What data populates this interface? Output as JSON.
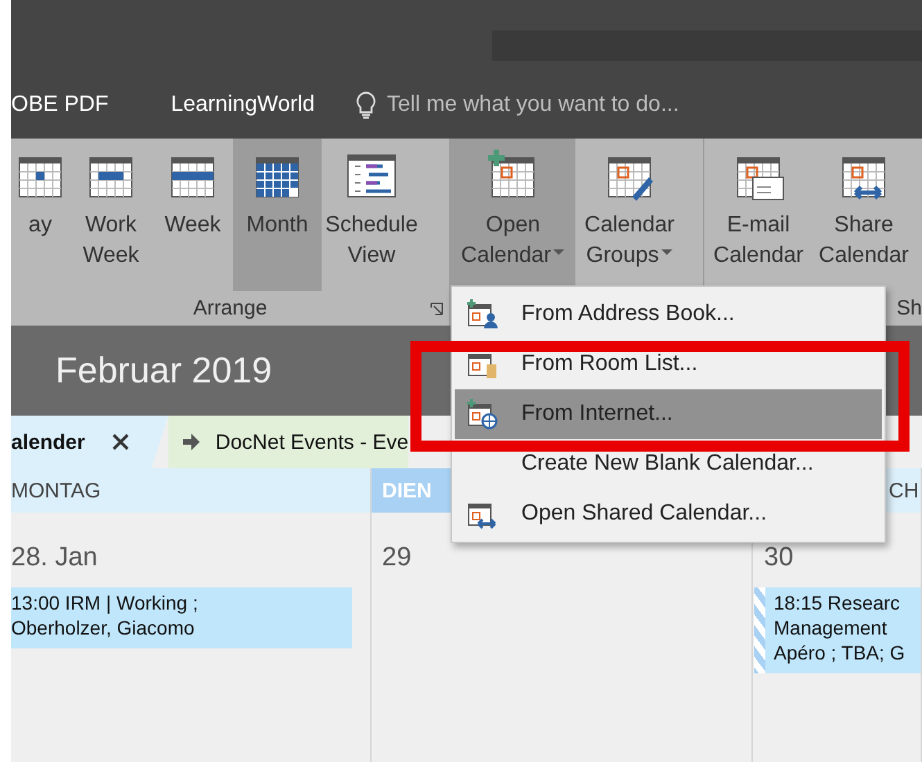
{
  "top_tabs": [
    {
      "label": "OBE PDF"
    },
    {
      "label": "LearningWorld"
    }
  ],
  "tell_me": {
    "placeholder": "Tell me what you want to do..."
  },
  "ribbon": {
    "buttons": [
      {
        "lines": [
          "ay"
        ],
        "selected": false,
        "pressed": false,
        "dropdown": false
      },
      {
        "lines": [
          "Work",
          "Week"
        ],
        "selected": false,
        "pressed": false,
        "dropdown": false
      },
      {
        "lines": [
          "Week"
        ],
        "selected": false,
        "pressed": false,
        "dropdown": false
      },
      {
        "lines": [
          "Month"
        ],
        "selected": true,
        "pressed": false,
        "dropdown": false
      },
      {
        "lines": [
          "Schedule",
          "View"
        ],
        "selected": false,
        "pressed": false,
        "dropdown": false
      },
      {
        "lines": [
          "Open",
          "Calendar"
        ],
        "selected": false,
        "pressed": true,
        "dropdown": true
      },
      {
        "lines": [
          "Calendar",
          "Groups"
        ],
        "selected": false,
        "pressed": false,
        "dropdown": true
      },
      {
        "lines": [
          "E-mail",
          "Calendar"
        ],
        "selected": false,
        "pressed": false,
        "dropdown": false
      },
      {
        "lines": [
          "Share",
          "Calendar"
        ],
        "selected": false,
        "pressed": false,
        "dropdown": false
      }
    ],
    "groups": [
      {
        "label": "Arrange"
      },
      {
        "label": "Sh"
      }
    ]
  },
  "date_title": "Februar 2019",
  "calendar_tabs": [
    {
      "label": "alender",
      "selected": true,
      "closable": true,
      "color": "#dcf0fb"
    },
    {
      "label": "DocNet Events - Eve",
      "selected": false,
      "closable": false,
      "color": "#e2f0d9"
    }
  ],
  "days": [
    {
      "header": "MONTAG",
      "selected": false,
      "date": "28. Jan",
      "events": [
        {
          "lines": [
            "13:00 IRM | Working ;",
            "Oberholzer, Giacomo"
          ],
          "tentative": false
        }
      ]
    },
    {
      "header": "DIEN",
      "selected": true,
      "date": "29"
    },
    {
      "header": "CH",
      "selected": false,
      "date": "30",
      "events": [
        {
          "lines": [
            "18:15 Researc",
            "Management",
            "Apéro ; TBA; G"
          ],
          "tentative": true
        }
      ]
    }
  ],
  "menu": [
    {
      "label": "From Address Book...",
      "highlighted": false
    },
    {
      "label": "From Room List...",
      "highlighted": false
    },
    {
      "label": "From Internet...",
      "highlighted": true
    },
    {
      "label": "Create New Blank Calendar...",
      "highlighted": false
    },
    {
      "label": "Open Shared Calendar...",
      "highlighted": false
    }
  ]
}
